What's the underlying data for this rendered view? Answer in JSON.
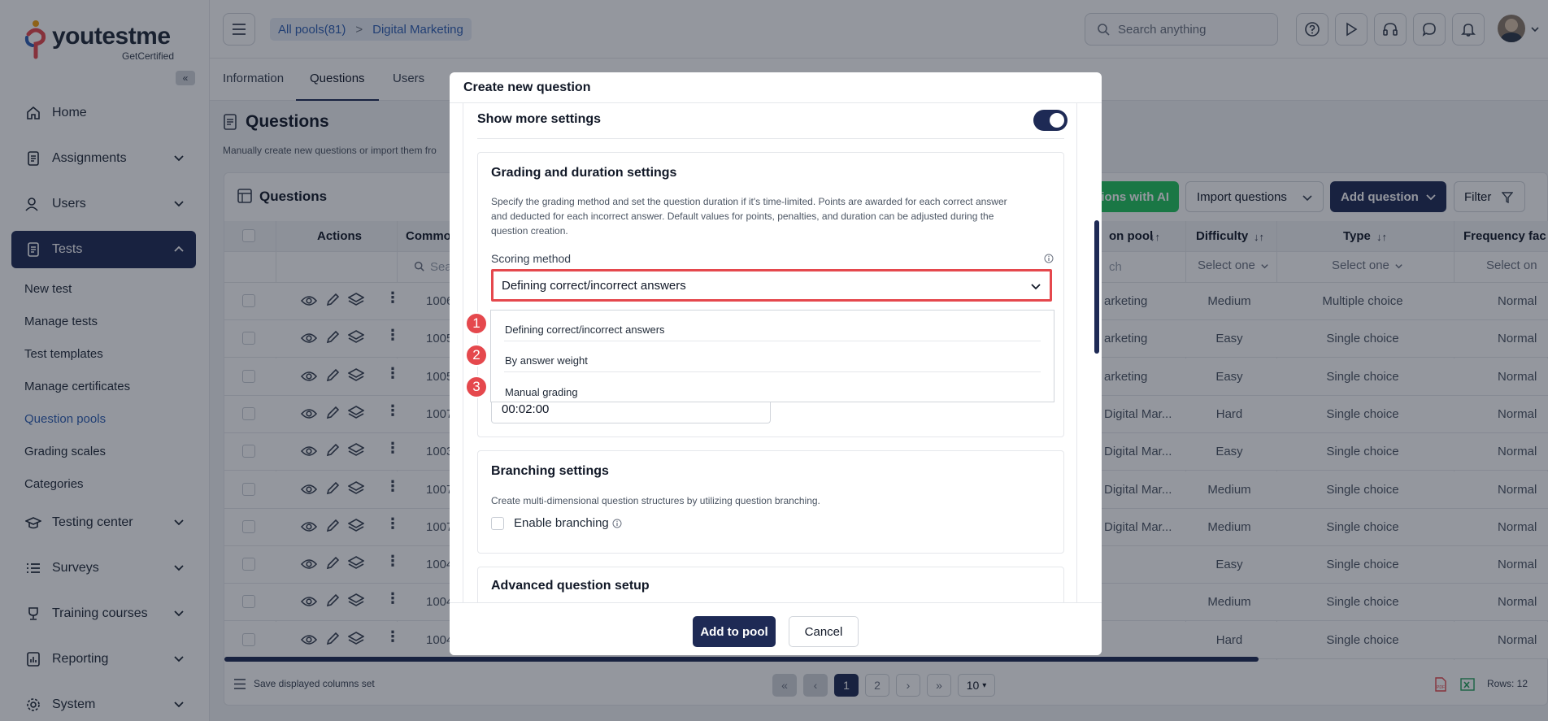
{
  "brand": {
    "name": "youtestme",
    "tagline": "GetCertified"
  },
  "sidebar": {
    "items": [
      {
        "label": "Home",
        "icon": "home-icon"
      },
      {
        "label": "Assignments",
        "icon": "assignments-icon"
      },
      {
        "label": "Users",
        "icon": "users-icon"
      },
      {
        "label": "Tests",
        "icon": "tests-icon"
      },
      {
        "label": "Testing center",
        "icon": "testing-center-icon"
      },
      {
        "label": "Surveys",
        "icon": "surveys-icon"
      },
      {
        "label": "Training courses",
        "icon": "training-icon"
      },
      {
        "label": "Reporting",
        "icon": "reporting-icon"
      },
      {
        "label": "System",
        "icon": "system-icon"
      }
    ],
    "tests_sub": [
      "New test",
      "Manage tests",
      "Test templates",
      "Manage certificates",
      "Question pools",
      "Grading scales",
      "Categories"
    ]
  },
  "header": {
    "breadcrumb": [
      "All pools(81)",
      ">",
      "Digital Marketing"
    ],
    "search_placeholder": "Search anything"
  },
  "tabs": [
    "Information",
    "Questions",
    "Users"
  ],
  "page": {
    "title": "Questions",
    "subtitle": "Manually create new questions or import them fro"
  },
  "table": {
    "card_title": "Questions",
    "actions": {
      "ai": "tions with AI",
      "import": "Import questions",
      "add": "Add question",
      "filter": "Filter"
    },
    "columns": [
      "Actions",
      "Commo",
      "on pool",
      "Difficulty",
      "Type",
      "Frequency fac"
    ],
    "filters": {
      "search": "Sea",
      "pool": "ch",
      "difficulty": "Select one",
      "type": "Select one",
      "freq": "Select on"
    },
    "rows": [
      {
        "id": "1006",
        "pool": "arketing",
        "difficulty": "Medium",
        "type": "Multiple choice",
        "freq": "Normal"
      },
      {
        "id": "1005",
        "pool": "arketing",
        "difficulty": "Easy",
        "type": "Single choice",
        "freq": "Normal"
      },
      {
        "id": "1005",
        "pool": "arketing",
        "difficulty": "Easy",
        "type": "Single choice",
        "freq": "Normal"
      },
      {
        "id": "1007",
        "pool": "Digital Mar...",
        "difficulty": "Hard",
        "type": "Single choice",
        "freq": "Normal"
      },
      {
        "id": "1003",
        "pool": "Digital Mar...",
        "difficulty": "Easy",
        "type": "Single choice",
        "freq": "Normal"
      },
      {
        "id": "1007",
        "pool": "Digital Mar...",
        "difficulty": "Medium",
        "type": "Single choice",
        "freq": "Normal"
      },
      {
        "id": "1007",
        "pool": "Digital Mar...",
        "difficulty": "Medium",
        "type": "Single choice",
        "freq": "Normal"
      },
      {
        "id": "1004",
        "pool": "",
        "difficulty": "Easy",
        "type": "Single choice",
        "freq": "Normal"
      },
      {
        "id": "1004",
        "pool": "",
        "difficulty": "Medium",
        "type": "Single choice",
        "freq": "Normal"
      },
      {
        "id": "1004",
        "pool": "",
        "difficulty": "Hard",
        "type": "Single choice",
        "freq": "Normal"
      }
    ],
    "footer": {
      "save_columns": "Save displayed columns set",
      "pages": [
        "1",
        "2"
      ],
      "page_size": "10",
      "rows": "Rows: 12"
    }
  },
  "modal": {
    "title": "Create new question",
    "show_more": "Show more settings",
    "grading": {
      "title": "Grading and duration settings",
      "desc_lines": [
        "Specify the grading method and set the question duration if it's time-limited. Points are awarded for each correct answer",
        "and deducted for each incorrect answer. Default values for points, penalties, and duration can be adjusted during the",
        "question creation."
      ],
      "scoring_label": "Scoring method",
      "scoring_value": "Defining correct/incorrect answers",
      "options": [
        "Defining correct/incorrect answers",
        "By answer weight",
        "Manual grading"
      ],
      "badges": [
        "1",
        "2",
        "3"
      ],
      "duration": "00:02:00"
    },
    "branching": {
      "title": "Branching settings",
      "desc": "Create multi-dimensional question structures by utilizing question branching.",
      "enable": "Enable branching"
    },
    "advanced": {
      "title": "Advanced question setup"
    },
    "add_btn": "Add to pool",
    "cancel_btn": "Cancel"
  },
  "colors": {
    "navy": "#1e2a55",
    "accent_red": "#e5484d",
    "link": "#2f5fb3",
    "green": "#22c55e"
  }
}
